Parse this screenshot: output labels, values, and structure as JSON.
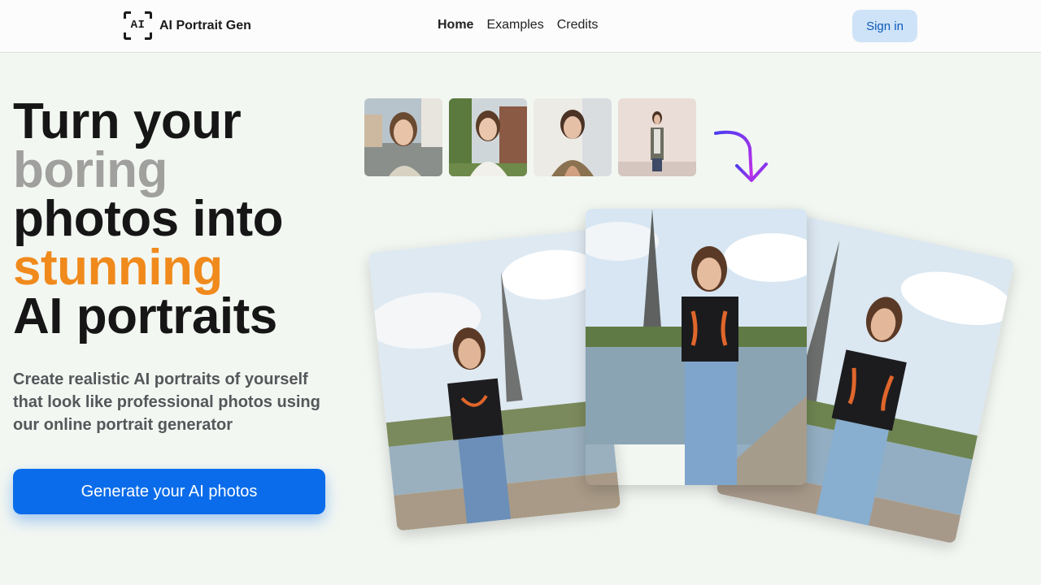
{
  "header": {
    "logo_mark": "AI",
    "logo_text": "AI Portrait Gen",
    "nav": [
      {
        "label": "Home",
        "active": true
      },
      {
        "label": "Examples",
        "active": false
      },
      {
        "label": "Credits",
        "active": false
      }
    ],
    "signin_label": "Sign in"
  },
  "hero": {
    "headline": [
      "Turn your",
      "boring",
      "photos into",
      "stunning",
      "AI portraits"
    ],
    "subtext": "Create realistic AI portraits of yourself that look like professional photos using our online portrait generator",
    "cta_label": "Generate your AI photos"
  },
  "colors": {
    "accent": "#0a6cea",
    "highlight_orange": "#f08a1c",
    "highlight_grey": "#a0a09f",
    "arrow_gradient": [
      "#4b3df0",
      "#c42ee8"
    ]
  },
  "icons": {
    "arrow": "curved-down-arrow-icon",
    "logo": "ai-frame-icon"
  }
}
